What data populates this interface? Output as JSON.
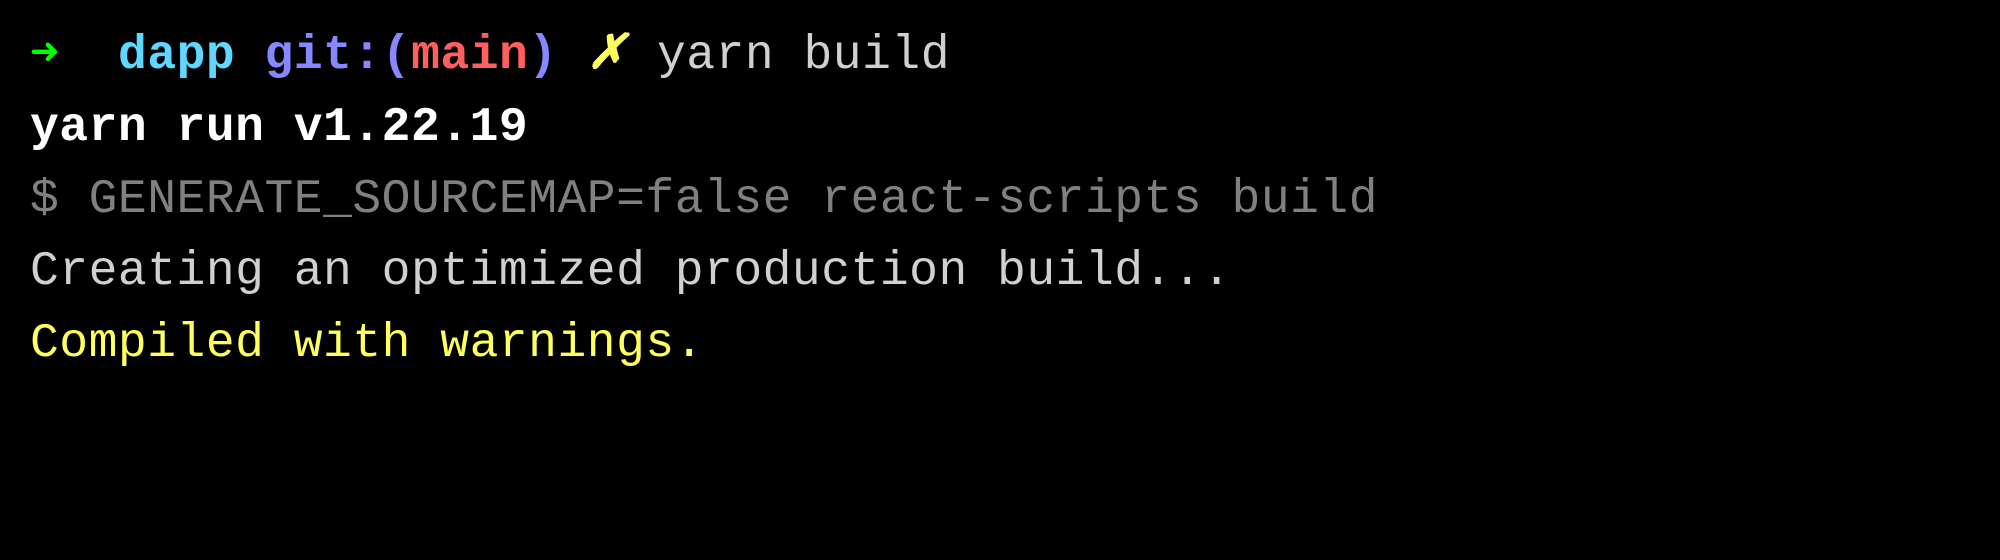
{
  "prompt": {
    "arrow": "➜",
    "cwd": "dapp",
    "git_label": "git:",
    "paren_open": "(",
    "branch": "main",
    "paren_close": ")",
    "dirty_marker": "✗",
    "command": "yarn build"
  },
  "output": {
    "yarn_version_line": "yarn run v1.22.19",
    "dollar": "$",
    "script_command": "GENERATE_SOURCEMAP=false react-scripts build",
    "status_line": "Creating an optimized production build...",
    "warning_line": "Compiled with warnings."
  }
}
